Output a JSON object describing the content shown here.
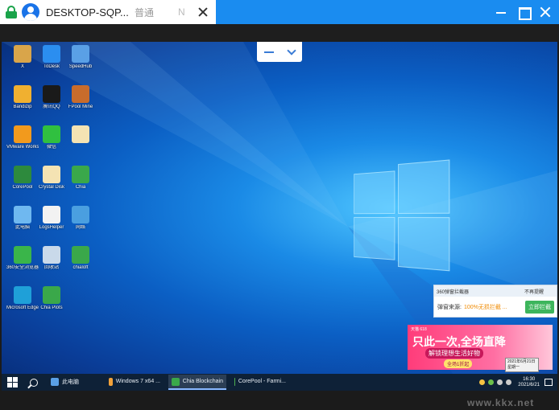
{
  "client": {
    "tab_title": "DESKTOP-SQP...",
    "tab_mode": "普通",
    "tab_n": "N"
  },
  "desktop_icons": [
    {
      "label": "X",
      "color": "#d9a54a"
    },
    {
      "label": "ToDesk",
      "color": "#2b8ef0"
    },
    {
      "label": "SpeedHub",
      "color": "#5aa0e6"
    },
    {
      "label": "Bandizip",
      "color": "#f0b030"
    },
    {
      "label": "腾讯QQ",
      "color": "#1a1a1a"
    },
    {
      "label": "FPool Mine",
      "color": "#c86c2c"
    },
    {
      "label": "VMware Workstation",
      "color": "#f29a1d"
    },
    {
      "label": "微信",
      "color": "#30c040"
    },
    {
      "label": "",
      "color": "#f4e3b3"
    },
    {
      "label": "CorePool",
      "color": "#2d8a3d"
    },
    {
      "label": "Crystal Disk",
      "color": "#f4e3b3"
    },
    {
      "label": "Chia",
      "color": "#3aa84a"
    },
    {
      "label": "此电脑",
      "color": "#6fb8f0"
    },
    {
      "label": "LogsHelper",
      "color": "#f2f2f2"
    },
    {
      "label": "网络",
      "color": "#4a9fe0"
    },
    {
      "label": "360安全浏览器",
      "color": "#3ab54a"
    },
    {
      "label": "回收站",
      "color": "#c9d9ea"
    },
    {
      "label": "chialoft",
      "color": "#3aa84a"
    },
    {
      "label": "Microsoft Edge",
      "color": "#1fa0d8"
    },
    {
      "label": "Chia Plots",
      "color": "#3aa84a"
    }
  ],
  "taskbar": {
    "items": [
      {
        "label": "此电脑",
        "color": "#5aa0e6",
        "active": false
      },
      {
        "label": "Windows 7 x64 ...",
        "color": "#f2a23a",
        "active": false
      },
      {
        "label": "Chia Blockchain",
        "color": "#3aa84a",
        "active": true
      },
      {
        "label": "CorePool - Farmi...",
        "color": "#4caf50",
        "active": false
      }
    ],
    "clock_time": "16:30",
    "clock_date": "2021/6/21"
  },
  "popup_cleaner": {
    "header": "360弹窗拦截器",
    "header_right": "不再提醒",
    "text_label": "弹窗来源:",
    "text_value": "100%无损拦截 ...",
    "cta": "立即拦截"
  },
  "popup_ad": {
    "badge": "天猫 618",
    "headline": "只此一次,全场直降",
    "sub": "解锁理想生活好物",
    "pill": "全场1折起"
  },
  "tooltip": {
    "line1": "2021年6月21日",
    "line2": "星期一"
  },
  "watermark": "www.kkx.net"
}
